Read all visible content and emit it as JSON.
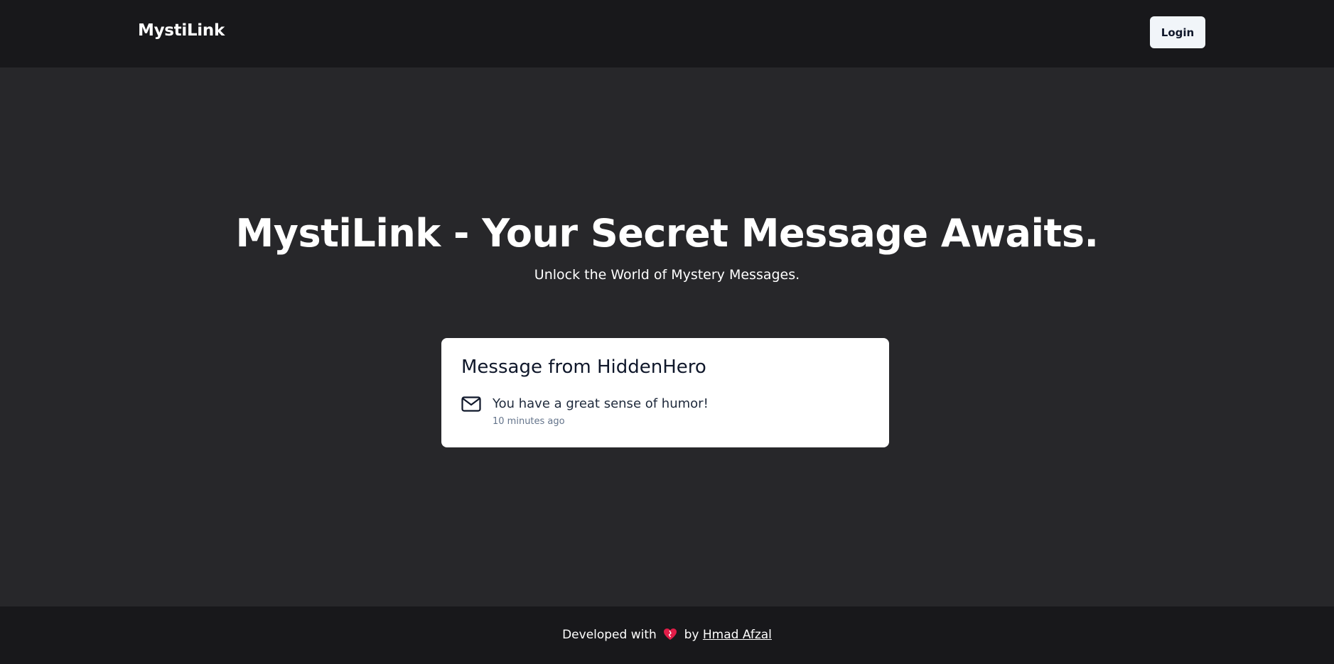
{
  "navbar": {
    "brand": "MystiLink",
    "login_label": "Login"
  },
  "hero": {
    "title": "MystiLink - Your Secret Message Awaits.",
    "subtitle": "Unlock the World of Mystery Messages."
  },
  "message_card": {
    "title": "Message from HiddenHero",
    "icon": "mail-icon",
    "text": "You have a great sense of humor!",
    "time": "10 minutes ago"
  },
  "footer": {
    "prefix": "Developed with",
    "heart_icon": "heart-icon",
    "by": "by",
    "author": "Hmad Afzal"
  },
  "colors": {
    "navbar_bg": "#18181b",
    "main_bg": "#27272a",
    "card_bg": "#ffffff",
    "button_bg": "#f1f5f9",
    "heart": "#e11d48"
  }
}
